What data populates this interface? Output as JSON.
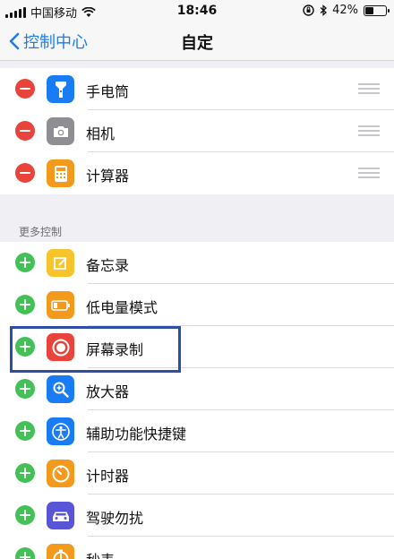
{
  "status": {
    "carrier": "中国移动",
    "time": "18:46",
    "battery": "42%",
    "battery_level": 0.42
  },
  "nav": {
    "back_label": "控制中心",
    "title": "自定"
  },
  "included": {
    "items": [
      {
        "label": "手电筒",
        "icon": "flashlight-icon",
        "color": "#1a7cf5"
      },
      {
        "label": "相机",
        "icon": "camera-icon",
        "color": "#8e8e93"
      },
      {
        "label": "计算器",
        "icon": "calculator-icon",
        "color": "#f39a1d"
      }
    ]
  },
  "more": {
    "header": "更多控制",
    "items": [
      {
        "label": "备忘录",
        "icon": "notes-icon",
        "color": "#f7c52b"
      },
      {
        "label": "低电量模式",
        "icon": "battery-icon",
        "color": "#f39a1d"
      },
      {
        "label": "屏幕录制",
        "icon": "screen-record-icon",
        "color": "#e8443b"
      },
      {
        "label": "放大器",
        "icon": "magnifier-icon",
        "color": "#1a7cf5"
      },
      {
        "label": "辅助功能快捷键",
        "icon": "accessibility-icon",
        "color": "#1a7cf5"
      },
      {
        "label": "计时器",
        "icon": "timer-icon",
        "color": "#f39a1d"
      },
      {
        "label": "驾驶勿扰",
        "icon": "car-icon",
        "color": "#5856d6"
      },
      {
        "label": "秒表",
        "icon": "stopwatch-icon",
        "color": "#f39a1d"
      }
    ]
  }
}
